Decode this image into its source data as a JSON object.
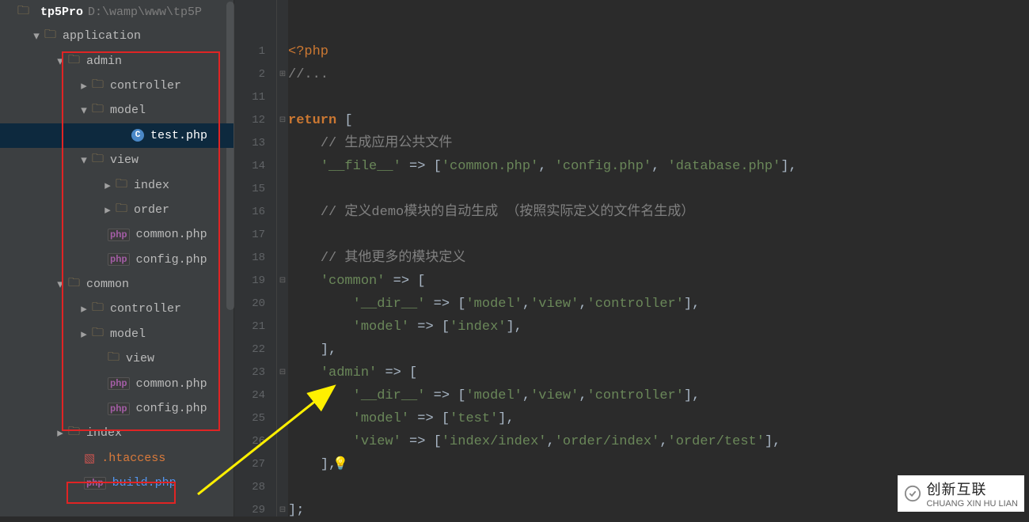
{
  "project": {
    "name": "tp5Pro",
    "path": "D:\\wamp\\www\\tp5P"
  },
  "tree": [
    {
      "indent": 40,
      "chev": "down",
      "icon": "folder",
      "label": "application"
    },
    {
      "indent": 70,
      "chev": "down",
      "icon": "folder",
      "label": "admin"
    },
    {
      "indent": 100,
      "chev": "right",
      "icon": "folder",
      "label": "controller"
    },
    {
      "indent": 100,
      "chev": "down",
      "icon": "folder",
      "label": "model"
    },
    {
      "indent": 150,
      "chev": "blank",
      "icon": "class",
      "label": "test.php",
      "selected": true
    },
    {
      "indent": 100,
      "chev": "down",
      "icon": "folder",
      "label": "view"
    },
    {
      "indent": 130,
      "chev": "right",
      "icon": "folder",
      "label": "index"
    },
    {
      "indent": 130,
      "chev": "right",
      "icon": "folder",
      "label": "order"
    },
    {
      "indent": 120,
      "chev": "blank",
      "icon": "php",
      "label": "common.php"
    },
    {
      "indent": 120,
      "chev": "blank",
      "icon": "php",
      "label": "config.php"
    },
    {
      "indent": 70,
      "chev": "down",
      "icon": "folder",
      "label": "common"
    },
    {
      "indent": 100,
      "chev": "right",
      "icon": "folder",
      "label": "controller"
    },
    {
      "indent": 100,
      "chev": "right",
      "icon": "folder",
      "label": "model"
    },
    {
      "indent": 120,
      "chev": "blank",
      "icon": "folder",
      "label": "view"
    },
    {
      "indent": 120,
      "chev": "blank",
      "icon": "php",
      "label": "common.php"
    },
    {
      "indent": 120,
      "chev": "blank",
      "icon": "php",
      "label": "config.php"
    },
    {
      "indent": 70,
      "chev": "right",
      "icon": "folder",
      "label": "index"
    },
    {
      "indent": 90,
      "chev": "blank",
      "icon": "ht",
      "label": ".htaccess",
      "cls": "orange"
    },
    {
      "indent": 90,
      "chev": "blank",
      "icon": "php",
      "label": "build.php",
      "cls": "blue"
    }
  ],
  "gutter_lines": [
    "1",
    "2",
    "11",
    "12",
    "13",
    "14",
    "15",
    "16",
    "17",
    "18",
    "19",
    "20",
    "21",
    "22",
    "23",
    "24",
    "25",
    "26",
    "27",
    "28",
    "29"
  ],
  "code_lines": [
    {
      "html": "<span class='ct'>&lt;?php</span>"
    },
    {
      "html": "<span class='cc'>//...</span>"
    },
    {
      "html": ""
    },
    {
      "html": "<span class='ck'>return</span> <span class='cp'>[</span>"
    },
    {
      "html": "    <span class='cc'>// 生成应用公共文件</span>"
    },
    {
      "html": "    <span class='cs'>'__file__'</span> <span class='cp'>=&gt; [</span><span class='cs'>'common.php'</span><span class='cp'>, </span><span class='cs'>'config.php'</span><span class='cp'>, </span><span class='cs'>'database.php'</span><span class='cp'>],</span>"
    },
    {
      "html": ""
    },
    {
      "html": "    <span class='cc'>// 定义demo模块的自动生成 （按照实际定义的文件名生成）</span>"
    },
    {
      "html": ""
    },
    {
      "html": "    <span class='cc'>// 其他更多的模块定义</span>"
    },
    {
      "html": "    <span class='cs'>'common'</span> <span class='cp'>=&gt; [</span>"
    },
    {
      "html": "        <span class='cs'>'__dir__'</span> <span class='cp'>=&gt; [</span><span class='cs'>'model'</span><span class='cp'>,</span><span class='cs'>'view'</span><span class='cp'>,</span><span class='cs'>'controller'</span><span class='cp'>],</span>"
    },
    {
      "html": "        <span class='cs'>'model'</span> <span class='cp'>=&gt; [</span><span class='cs'>'index'</span><span class='cp'>],</span>"
    },
    {
      "html": "    <span class='cp'>],</span>"
    },
    {
      "html": "    <span class='cs'>'admin'</span> <span class='cp'>=&gt; [</span>"
    },
    {
      "html": "        <span class='cs'>'__dir__'</span> <span class='cp'>=&gt; [</span><span class='cs'>'model'</span><span class='cp'>,</span><span class='cs'>'view'</span><span class='cp'>,</span><span class='cs'>'controller'</span><span class='cp'>],</span>"
    },
    {
      "html": "        <span class='cs'>'model'</span> <span class='cp'>=&gt; [</span><span class='cs'>'test'</span><span class='cp'>],</span>"
    },
    {
      "html": "        <span class='cs'>'view'</span> <span class='cp'>=&gt; [</span><span class='cs'>'index/index'</span><span class='cp'>,</span><span class='cs'>'order/index'</span><span class='cp'>,</span><span class='cs'>'order/test'</span><span class='cp'>],</span>"
    },
    {
      "html": "    <span class='cp'>],</span>"
    },
    {
      "html": "    "
    },
    {
      "html": "<span class='cp'>];</span>"
    }
  ],
  "watermark": {
    "brand": "创新互联",
    "sub": "CHUANG XIN HU LIAN"
  }
}
